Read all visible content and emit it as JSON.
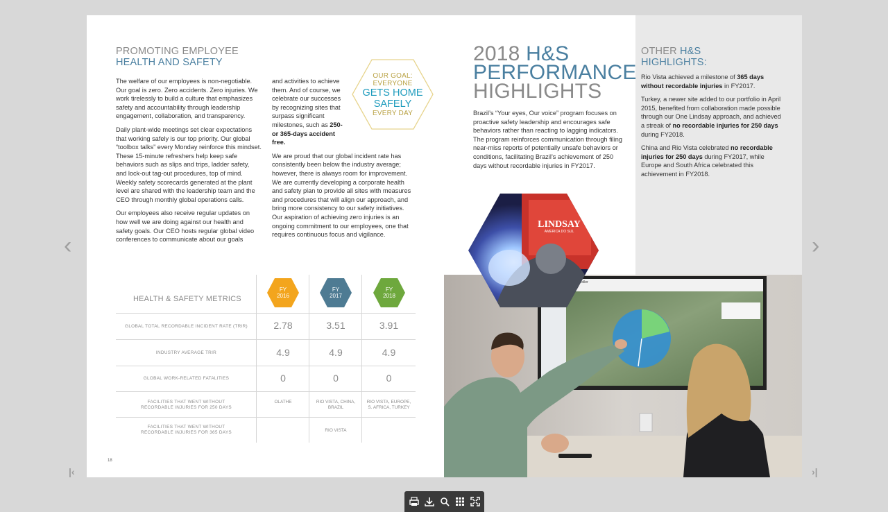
{
  "viewer": {
    "toolbar": [
      "print-icon",
      "download-icon",
      "search-icon",
      "grid-icon",
      "fullscreen-icon"
    ]
  },
  "left_page": {
    "title_line1": "PROMOTING EMPLOYEE",
    "title_line2": "HEALTH AND SAFETY",
    "col1": {
      "p1": "The welfare of our employees is non-negotiable. Our goal is zero. Zero accidents. Zero injuries. We work tirelessly to build a culture that emphasizes safety and accountability through leadership engagement, collaboration, and transparency.",
      "p2": "Daily plant-wide meetings set clear expectations that working safely is our top priority. Our global “toolbox talks” every Monday reinforce this mindset. These 15-minute refreshers help keep safe behaviors such as slips and trips, ladder safety, and lock-out tag-out procedures, top of mind. Weekly safety scorecards generated at the plant level are shared with the leadership team and the CEO through monthly global operations calls.",
      "p3": "Our employees also receive regular updates on how well we are doing against our health and safety goals. Our CEO hosts regular global video conferences to communicate about our goals"
    },
    "col2": {
      "p1_start": "and activities to achieve them. And of course, we celebrate our successes by recognizing sites that surpass significant milestones, such as ",
      "p1_bold": "250- or 365-days accident free.",
      "p2": "We are proud that our global incident rate has consistently been below the industry average; however, there is always room for improvement. We are currently developing a corporate health and safety plan to provide all sites with measures and procedures that will align our approach, and bring more consistency to our safety initiatives. Our aspiration of achieving zero injuries is an ongoing commitment to our employees, one that requires continuous focus and vigilance."
    },
    "goal": {
      "line1": "OUR GOAL:",
      "line2": "EVERYONE",
      "line3": "GETS HOME",
      "line4": "SAFELY",
      "line5": "EVERY DAY"
    },
    "metrics": {
      "title": "HEALTH & SAFETY METRICS",
      "years": [
        {
          "fy": "FY",
          "year": "2016",
          "color": "#f3a51d"
        },
        {
          "fy": "FY",
          "year": "2017",
          "color": "#4e7b93"
        },
        {
          "fy": "FY",
          "year": "2018",
          "color": "#6ea83d"
        }
      ],
      "rows": [
        {
          "label": "GLOBAL TOTAL RECORDABLE INCIDENT RATE (TRIR)",
          "values": [
            "2.78",
            "3.51",
            "3.91"
          ]
        },
        {
          "label": "INDUSTRY AVERAGE TRIR",
          "values": [
            "4.9",
            "4.9",
            "4.9"
          ]
        },
        {
          "label": "GLOBAL WORK-RELATED FATALITIES",
          "values": [
            "0",
            "0",
            "0"
          ]
        },
        {
          "label": "FACILITIES THAT WENT WITHOUT RECORDABLE INJURIES FOR 250 DAYS",
          "values": [
            "OLATHE",
            "RIO VISTA, CHINA, BRAZIL",
            "RIO VISTA, EUROPE, S. AFRICA, TURKEY"
          ]
        },
        {
          "label": "FACILITIES THAT WENT WITHOUT RECORDABLE INJURIES FOR 365 DAYS",
          "values": [
            "",
            "RIO VISTA",
            ""
          ]
        }
      ]
    },
    "page_number": "18"
  },
  "right_page": {
    "title_l1_gray": "2018 ",
    "title_l1_blue": "H&S",
    "title_l2": "PERFORMANCE",
    "title_l3": "HIGHLIGHTS",
    "body": "Brazil’s “Your eyes, Our voice” program focuses on proactive safety leadership and encourages safe behaviors rather than reacting to lagging indicators. The program reinforces communication through filing near-miss reports of potentially unsafe behaviors or conditions, facilitating Brazil’s achievement of 250 days without recordable injuries in FY2017.",
    "sidebar": {
      "title_gray": "OTHER ",
      "title_blue1": "H&S",
      "title_blue2": "HIGHLIGHTS:",
      "p1_a": "Rio Vista achieved a milestone of ",
      "p1_b": "365 days without recordable injuries",
      "p1_c": " in FY2017.",
      "p2_a": "Turkey, a newer site added to our portfolio in April 2015, benefited from collaboration made possible through our One Lindsay approach, and achieved a streak of ",
      "p2_b": "no recordable injuries for 250 days",
      "p2_c": " during FY2018.",
      "p3_a": "China and Rio Vista celebrated ",
      "p3_b": "no recordable injuries for 250 days",
      "p3_c": " during FY2017, while Europe and South Africa celebrated this achievement in FY2018."
    },
    "hex_photo": {
      "sign_line1": "LINDSAY",
      "sign_line2": "AMERICA DO SUL"
    },
    "photo": {
      "screen_title": "BI Controller"
    }
  }
}
